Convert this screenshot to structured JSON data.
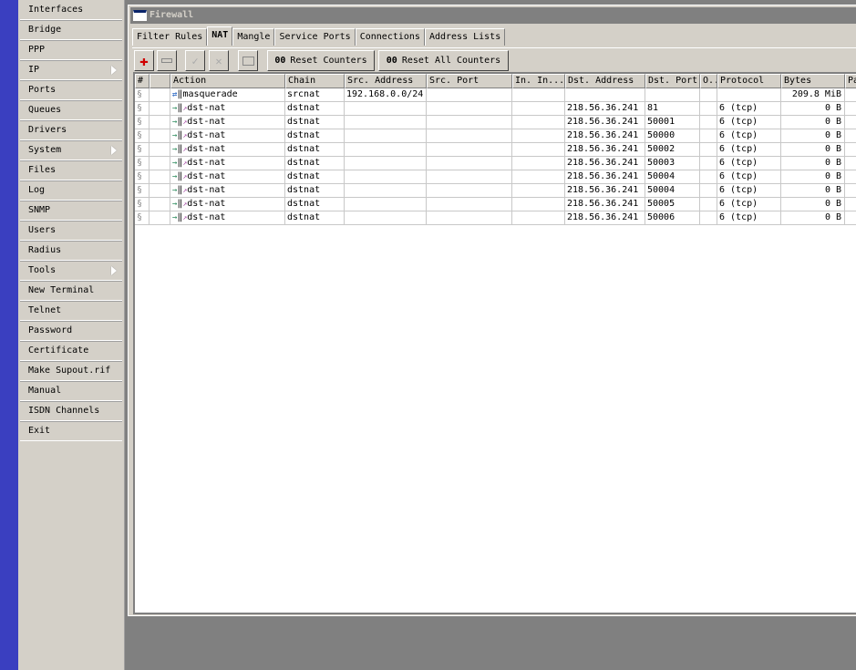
{
  "sidebar": {
    "items": [
      {
        "label": "Interfaces"
      },
      {
        "label": "Bridge"
      },
      {
        "label": "PPP"
      },
      {
        "label": "IP",
        "submenu": true
      },
      {
        "label": "Ports"
      },
      {
        "label": "Queues"
      },
      {
        "label": "Drivers"
      },
      {
        "label": "System",
        "submenu": true
      },
      {
        "label": "Files"
      },
      {
        "label": "Log"
      },
      {
        "label": "SNMP"
      },
      {
        "label": "Users"
      },
      {
        "label": "Radius"
      },
      {
        "label": "Tools",
        "submenu": true
      },
      {
        "label": "New Terminal"
      },
      {
        "label": "Telnet"
      },
      {
        "label": "Password"
      },
      {
        "label": "Certificate"
      },
      {
        "label": "Make Supout.rif"
      },
      {
        "label": "Manual"
      },
      {
        "label": "ISDN Channels"
      },
      {
        "label": "Exit"
      }
    ]
  },
  "window": {
    "title": "Firewall"
  },
  "tabs": [
    {
      "label": "Filter Rules"
    },
    {
      "label": "NAT",
      "active": true
    },
    {
      "label": "Mangle"
    },
    {
      "label": "Service Ports"
    },
    {
      "label": "Connections"
    },
    {
      "label": "Address Lists"
    }
  ],
  "toolbar": {
    "add": "plus-icon",
    "remove": "minus-icon",
    "enable": "check-icon",
    "disable": "cross-icon",
    "comment": "note-icon",
    "reset_counters": "Reset Counters",
    "reset_all_counters": "Reset All Counters",
    "counter_glyph": "00"
  },
  "table": {
    "columns": [
      "#",
      "",
      "Action",
      "Chain",
      "Src. Address",
      "Src. Port",
      "In. In...",
      "Dst. Address",
      "Dst. Port",
      "O..",
      "Protocol",
      "Bytes",
      "Pa"
    ],
    "rows": [
      {
        "action": "masquerade",
        "chain": "srcnat",
        "src_address": "192.168.0.0/24",
        "dst_address": "",
        "dst_port": "",
        "protocol": "",
        "bytes": "209.8 MiB"
      },
      {
        "action": "dst-nat",
        "chain": "dstnat",
        "src_address": "",
        "dst_address": "218.56.36.241",
        "dst_port": "81",
        "protocol": "6 (tcp)",
        "bytes": "0 B"
      },
      {
        "action": "dst-nat",
        "chain": "dstnat",
        "src_address": "",
        "dst_address": "218.56.36.241",
        "dst_port": "50001",
        "protocol": "6 (tcp)",
        "bytes": "0 B"
      },
      {
        "action": "dst-nat",
        "chain": "dstnat",
        "src_address": "",
        "dst_address": "218.56.36.241",
        "dst_port": "50000",
        "protocol": "6 (tcp)",
        "bytes": "0 B"
      },
      {
        "action": "dst-nat",
        "chain": "dstnat",
        "src_address": "",
        "dst_address": "218.56.36.241",
        "dst_port": "50002",
        "protocol": "6 (tcp)",
        "bytes": "0 B"
      },
      {
        "action": "dst-nat",
        "chain": "dstnat",
        "src_address": "",
        "dst_address": "218.56.36.241",
        "dst_port": "50003",
        "protocol": "6 (tcp)",
        "bytes": "0 B"
      },
      {
        "action": "dst-nat",
        "chain": "dstnat",
        "src_address": "",
        "dst_address": "218.56.36.241",
        "dst_port": "50004",
        "protocol": "6 (tcp)",
        "bytes": "0 B"
      },
      {
        "action": "dst-nat",
        "chain": "dstnat",
        "src_address": "",
        "dst_address": "218.56.36.241",
        "dst_port": "50004",
        "protocol": "6 (tcp)",
        "bytes": "0 B"
      },
      {
        "action": "dst-nat",
        "chain": "dstnat",
        "src_address": "",
        "dst_address": "218.56.36.241",
        "dst_port": "50005",
        "protocol": "6 (tcp)",
        "bytes": "0 B"
      },
      {
        "action": "dst-nat",
        "chain": "dstnat",
        "src_address": "",
        "dst_address": "218.56.36.241",
        "dst_port": "50006",
        "protocol": "6 (tcp)",
        "bytes": "0 B"
      }
    ]
  }
}
